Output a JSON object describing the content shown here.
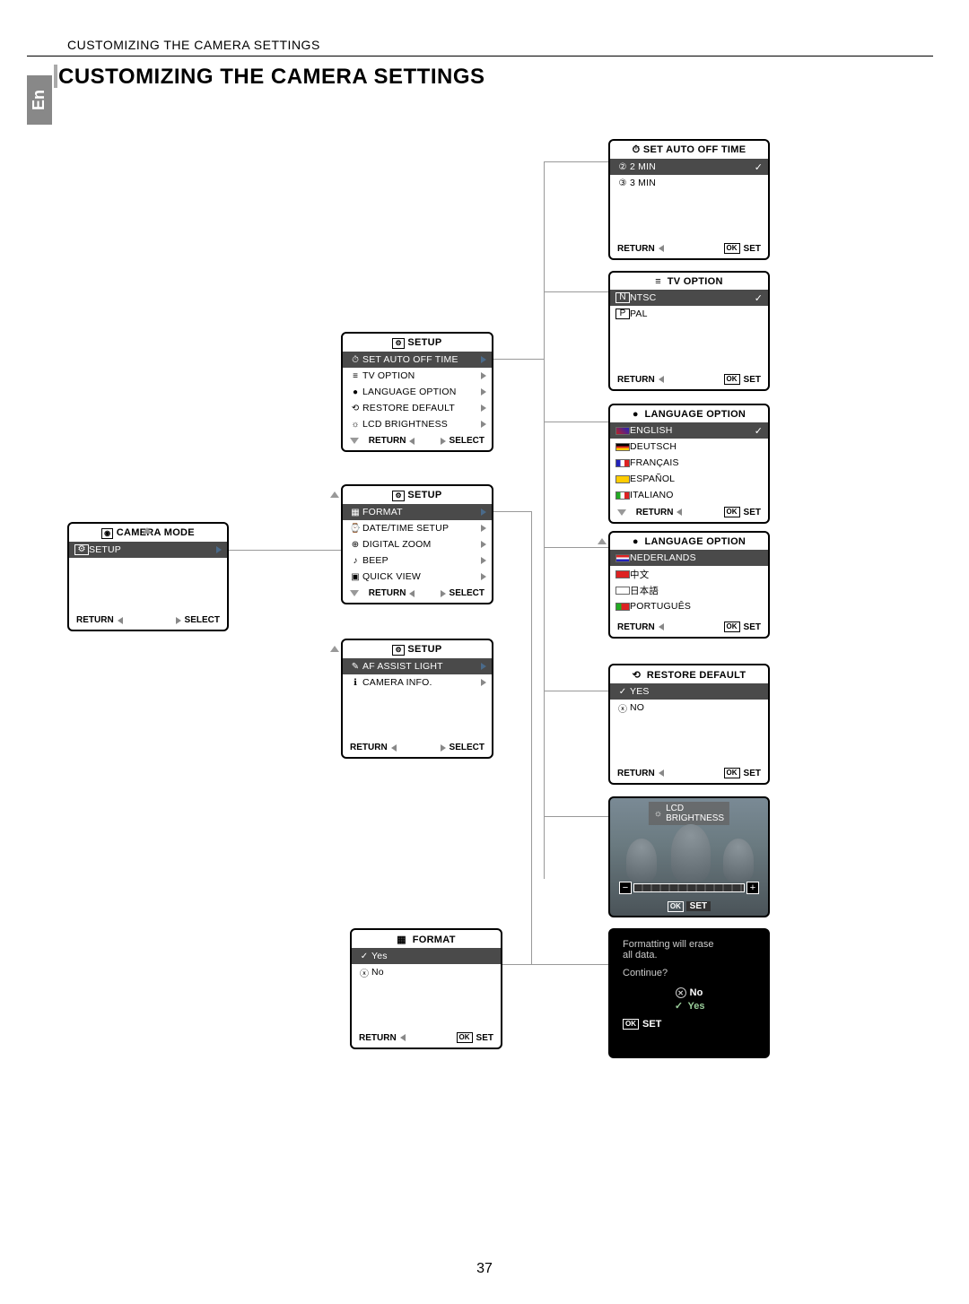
{
  "header": "CUSTOMIZING THE CAMERA SETTINGS",
  "title": "CUSTOMIZING THE CAMERA SETTINGS",
  "lang_tab": "En",
  "page_number": "37",
  "labels": {
    "return": "RETURN",
    "select": "SELECT",
    "set": "SET",
    "ok": "OK"
  },
  "camera_mode": {
    "title": "CAMERA MODE",
    "items": [
      {
        "label": "SETUP",
        "selected": true
      }
    ]
  },
  "setup1": {
    "title": "SETUP",
    "items": [
      {
        "label": "SET AUTO OFF TIME",
        "selected": true
      },
      {
        "label": "TV OPTION"
      },
      {
        "label": "LANGUAGE OPTION"
      },
      {
        "label": "RESTORE DEFAULT"
      },
      {
        "label": "LCD BRIGHTNESS"
      }
    ]
  },
  "setup2": {
    "title": "SETUP",
    "items": [
      {
        "label": "FORMAT",
        "selected": true
      },
      {
        "label": "DATE/TIME SETUP"
      },
      {
        "label": "DIGITAL ZOOM"
      },
      {
        "label": "BEEP"
      },
      {
        "label": "QUICK VIEW"
      }
    ]
  },
  "setup3": {
    "title": "SETUP",
    "items": [
      {
        "label": "AF ASSIST LIGHT",
        "selected": true
      },
      {
        "label": "CAMERA INFO."
      }
    ]
  },
  "auto_off": {
    "title": "SET AUTO OFF TIME",
    "items": [
      {
        "label": "2 MIN",
        "selected": true,
        "checked": true
      },
      {
        "label": "3 MIN"
      }
    ]
  },
  "tv_option": {
    "title": "TV  OPTION",
    "items": [
      {
        "label": "NTSC",
        "selected": true,
        "checked": true
      },
      {
        "label": "PAL"
      }
    ]
  },
  "lang1": {
    "title": "LANGUAGE  OPTION",
    "items": [
      {
        "label": "ENGLISH",
        "selected": true,
        "checked": true
      },
      {
        "label": "DEUTSCH"
      },
      {
        "label": "FRANÇAIS"
      },
      {
        "label": "ESPAÑOL"
      },
      {
        "label": "ITALIANO"
      }
    ]
  },
  "lang2": {
    "title": "LANGUAGE  OPTION",
    "items": [
      {
        "label": "NEDERLANDS",
        "selected": true
      },
      {
        "label": "中文"
      },
      {
        "label": "日本語"
      },
      {
        "label": "PORTUGUÊS"
      }
    ]
  },
  "restore": {
    "title": "RESTORE DEFAULT",
    "items": [
      {
        "label": "YES",
        "selected": true,
        "icon": "check"
      },
      {
        "label": "NO",
        "icon": "x"
      }
    ]
  },
  "lcd": {
    "title": "LCD BRIGHTNESS",
    "minus": "−",
    "plus": "+",
    "set": "SET"
  },
  "format": {
    "title": "FORMAT",
    "items": [
      {
        "label": "Yes",
        "selected": true,
        "icon": "check"
      },
      {
        "label": "No",
        "icon": "x"
      }
    ]
  },
  "confirm": {
    "line1": "Formatting will erase",
    "line2": "all data.",
    "line3": "Continue?",
    "no": "No",
    "yes": "Yes",
    "set": "SET"
  }
}
